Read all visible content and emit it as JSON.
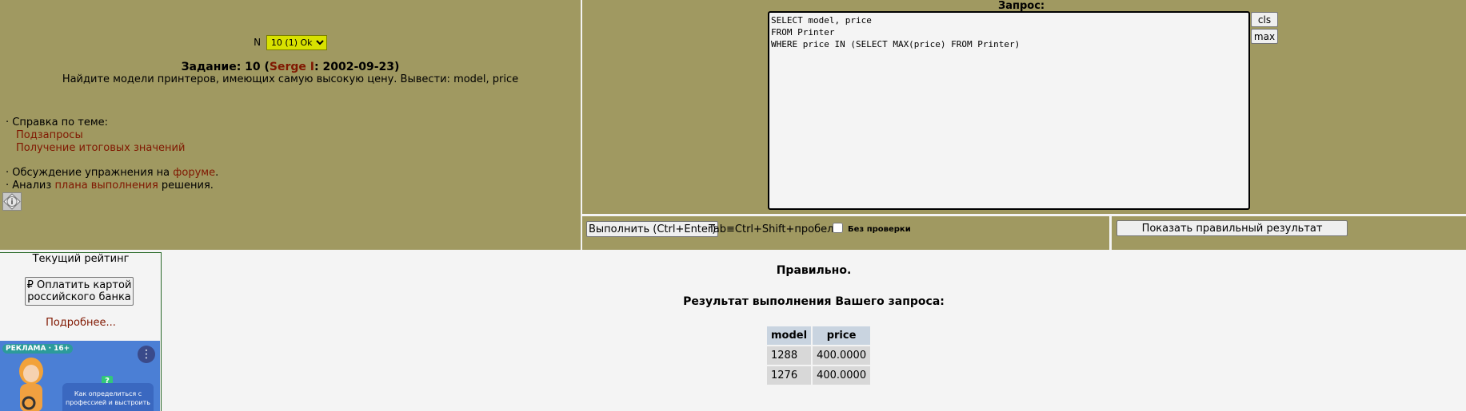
{
  "task": {
    "n_label": "N",
    "select_value": "10 (1) Ok",
    "title_prefix": "Задание: 10 (",
    "author": "Serge I",
    "title_suffix": ": 2002-09-23)",
    "description": "Найдите модели принтеров, имеющих самую высокую цену. Вывести: model, price"
  },
  "help": {
    "label": "· Справка по теме:",
    "links": [
      "Подзапросы",
      "Получение итоговых значений"
    ],
    "forum_prefix": "· Обсуждение упражнения на ",
    "forum_link": "форуме",
    "forum_suffix": ".",
    "plan_prefix": "· Анализ ",
    "plan_link": "плана выполнения",
    "plan_suffix": " решения."
  },
  "query": {
    "label": "Запрос:",
    "sql": "SELECT model, price\nFROM Printer\nWHERE price IN (SELECT MAX(price) FROM Printer)",
    "cls_label": "cls",
    "max_label": "max"
  },
  "exec": {
    "run_label": "Выполнить (Ctrl+Enter)",
    "tab_hint": "Tab≡Ctrl+Shift+пробел",
    "no_check_label": "Без проверки",
    "show_result_label": "Показать правильный результат"
  },
  "sidebar": {
    "rating_title": "Текущий рейтинг",
    "pay_label_1": "₽ Оплатить картой",
    "pay_label_2": "российского банка",
    "more_label": "Подробнее...",
    "ad_badge": "РЕКЛАМА · 16+",
    "ad_text": "Как определиться с профессией и выстроить"
  },
  "result": {
    "status": "Правильно.",
    "title": "Результат выполнения Вашего запроса:",
    "columns": [
      "model",
      "price"
    ],
    "rows": [
      [
        "1288",
        "400.0000"
      ],
      [
        "1276",
        "400.0000"
      ]
    ]
  }
}
